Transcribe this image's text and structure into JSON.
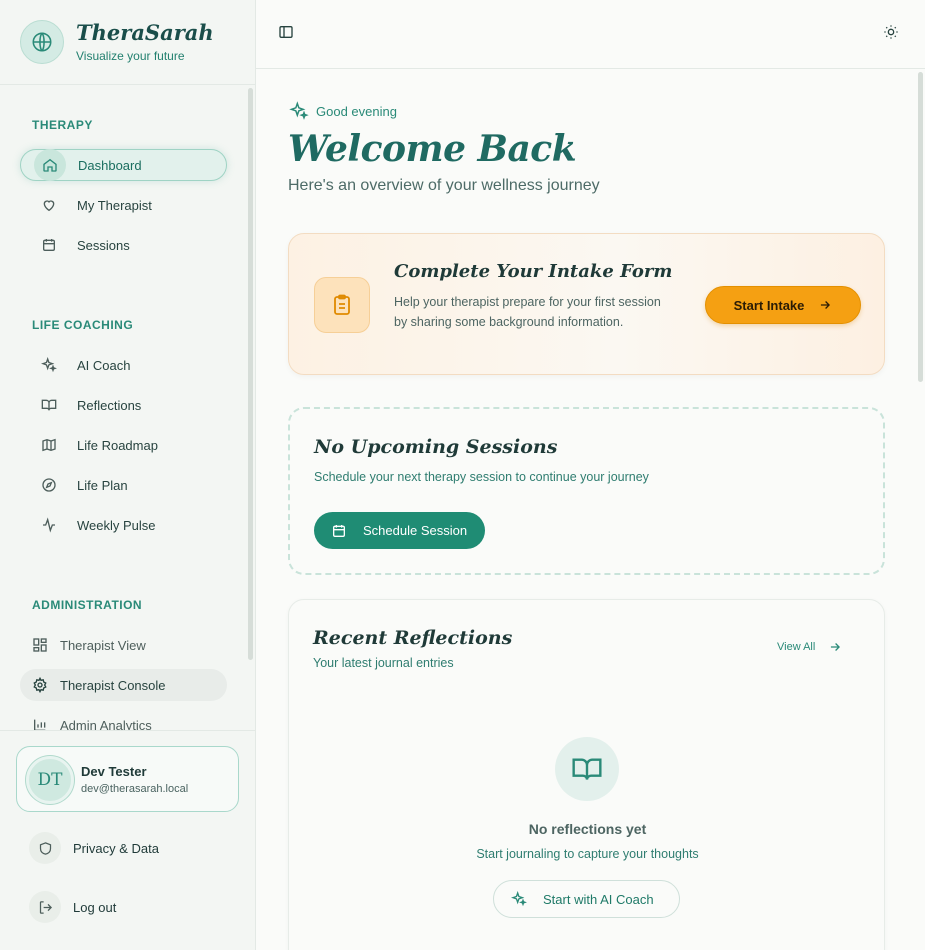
{
  "brand": {
    "name": "TheraSarah",
    "tagline": "Visualize your future"
  },
  "sidebar": {
    "sections": [
      {
        "title": "THERAPY",
        "items": [
          {
            "label": "Dashboard",
            "icon": "home-icon",
            "active": true
          },
          {
            "label": "My Therapist",
            "icon": "heart-icon"
          },
          {
            "label": "Sessions",
            "icon": "calendar-icon"
          }
        ]
      },
      {
        "title": "LIFE COACHING",
        "items": [
          {
            "label": "AI Coach",
            "icon": "sparkles-icon"
          },
          {
            "label": "Reflections",
            "icon": "book-icon"
          },
          {
            "label": "Life Roadmap",
            "icon": "map-icon"
          },
          {
            "label": "Life Plan",
            "icon": "compass-icon"
          },
          {
            "label": "Weekly Pulse",
            "icon": "activity-icon"
          }
        ]
      },
      {
        "title": "ADMINISTRATION",
        "items": [
          {
            "label": "Therapist View",
            "icon": "grid-icon"
          },
          {
            "label": "Therapist Console",
            "icon": "gear-icon"
          },
          {
            "label": "Admin Analytics",
            "icon": "bar-chart-icon"
          }
        ]
      }
    ],
    "user": {
      "initials": "DT",
      "name": "Dev Tester",
      "email": "dev@therasarah.local"
    },
    "privacy_label": "Privacy & Data",
    "logout_label": "Log out"
  },
  "main": {
    "greeting": "Good evening",
    "title": "Welcome Back",
    "subtitle": "Here's an overview of your wellness journey",
    "intake": {
      "title": "Complete Your Intake Form",
      "description": "Help your therapist prepare for your first session by sharing some background information.",
      "button": "Start Intake"
    },
    "sessions": {
      "title": "No Upcoming Sessions",
      "description": "Schedule your next therapy session to continue your journey",
      "button": "Schedule Session"
    },
    "reflections": {
      "title": "Recent Reflections",
      "subtitle": "Your latest journal entries",
      "view_all": "View All",
      "empty_title": "No reflections yet",
      "empty_desc": "Start journaling to capture your thoughts",
      "button": "Start with AI Coach"
    }
  },
  "colors": {
    "accent": "#1f8c74",
    "brand": "#1f6a62",
    "warning": "#f5a012"
  }
}
